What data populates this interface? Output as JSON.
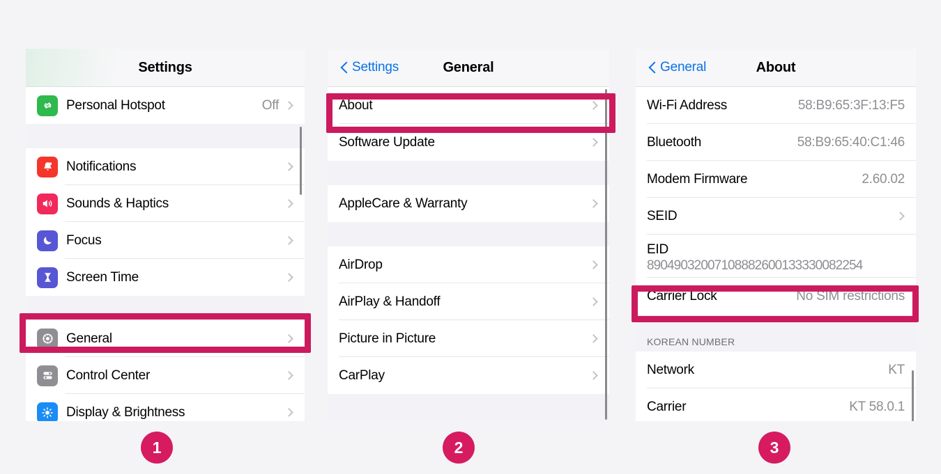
{
  "meta": {
    "accent_highlight": "#cc1a5e",
    "badge_color": "#d61b60",
    "link_blue": "#0a72e8",
    "value_gray": "#8e8e93"
  },
  "panel1": {
    "title": "Settings",
    "groups": [
      {
        "rows": [
          {
            "label": "Personal Hotspot",
            "value": "Off",
            "chevron": true,
            "icon": "hotspot-icon",
            "icon_color": "#30b94d"
          }
        ]
      },
      {
        "rows": [
          {
            "label": "Notifications",
            "value": "",
            "chevron": true,
            "icon": "notifications-bell-icon",
            "icon_color": "#f5362b"
          },
          {
            "label": "Sounds & Haptics",
            "value": "",
            "chevron": true,
            "icon": "sounds-speaker-icon",
            "icon_color": "#f2295b"
          },
          {
            "label": "Focus",
            "value": "",
            "chevron": true,
            "icon": "focus-moon-icon",
            "icon_color": "#5756d5"
          },
          {
            "label": "Screen Time",
            "value": "",
            "chevron": true,
            "icon": "screen-time-hourglass-icon",
            "icon_color": "#5756d5"
          }
        ]
      },
      {
        "rows": [
          {
            "label": "General",
            "value": "",
            "chevron": true,
            "icon": "gear-icon",
            "icon_color": "#8e8e93",
            "highlighted": true
          },
          {
            "label": "Control Center",
            "value": "",
            "chevron": true,
            "icon": "control-center-icon",
            "icon_color": "#8e8e93"
          },
          {
            "label": "Display & Brightness",
            "value": "",
            "chevron": true,
            "icon": "brightness-sun-icon",
            "icon_color": "#1a8cf5"
          }
        ]
      }
    ]
  },
  "panel2": {
    "back_label": "Settings",
    "title": "General",
    "groups": [
      {
        "rows": [
          {
            "label": "About",
            "value": "",
            "chevron": true,
            "highlighted": true
          },
          {
            "label": "Software Update",
            "value": "",
            "chevron": true
          }
        ]
      },
      {
        "rows": [
          {
            "label": "AppleCare & Warranty",
            "value": "",
            "chevron": true
          }
        ]
      },
      {
        "rows": [
          {
            "label": "AirDrop",
            "value": "",
            "chevron": true
          },
          {
            "label": "AirPlay & Handoff",
            "value": "",
            "chevron": true
          },
          {
            "label": "Picture in Picture",
            "value": "",
            "chevron": true
          },
          {
            "label": "CarPlay",
            "value": "",
            "chevron": true
          }
        ]
      }
    ]
  },
  "panel3": {
    "back_label": "General",
    "title": "About",
    "groups": [
      {
        "rows": [
          {
            "label": "Wi-Fi Address",
            "value": "58:B9:65:3F:13:F5",
            "chevron": false
          },
          {
            "label": "Bluetooth",
            "value": "58:B9:65:40:C1:46",
            "chevron": false
          },
          {
            "label": "Modem Firmware",
            "value": "2.60.02",
            "chevron": false
          },
          {
            "label": "SEID",
            "value": "",
            "chevron": true
          },
          {
            "label": "EID",
            "sub": "89049032007108882600133330082254",
            "twoline": true,
            "chevron": false
          },
          {
            "label": "Carrier Lock",
            "value": "No SIM restrictions",
            "chevron": false,
            "highlighted": true
          }
        ]
      },
      {
        "header": "KOREAN NUMBER",
        "rows": [
          {
            "label": "Network",
            "value": "KT",
            "chevron": false
          },
          {
            "label": "Carrier",
            "value": "KT 58.0.1",
            "chevron": false,
            "clipped": true
          }
        ]
      }
    ]
  },
  "steps": [
    {
      "number": "1"
    },
    {
      "number": "2"
    },
    {
      "number": "3"
    }
  ]
}
